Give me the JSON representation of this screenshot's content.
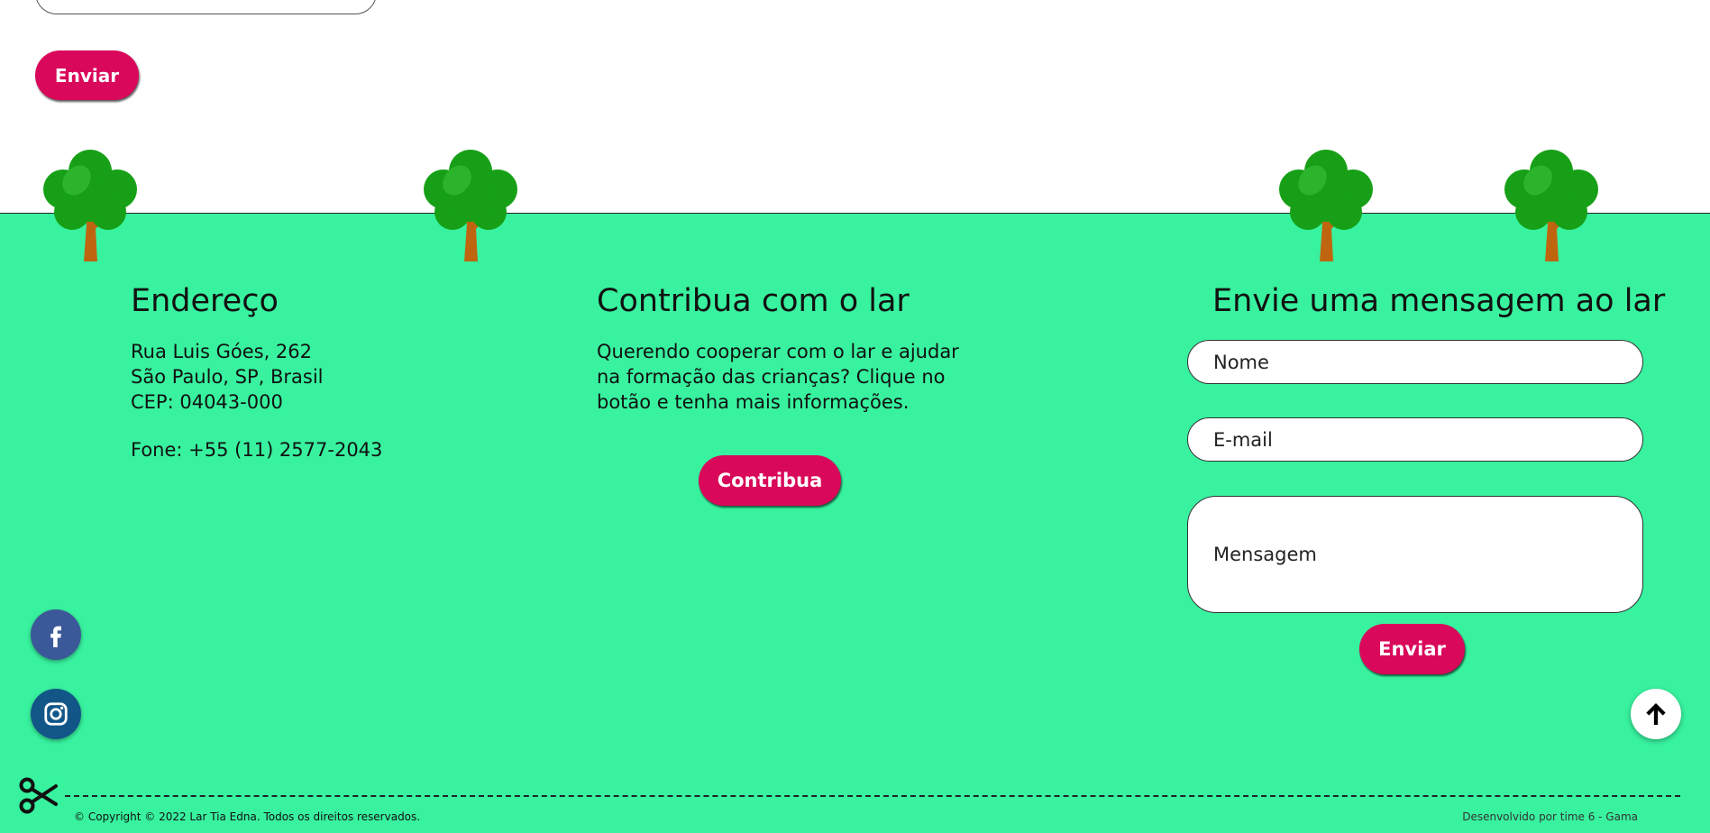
{
  "form_top": {
    "send_label": "Enviar"
  },
  "colors": {
    "accent": "#d9085a",
    "footer_bg": "#38f29f",
    "facebook": "#3b5998",
    "instagram": "#125688"
  },
  "address": {
    "title": "Endereço",
    "line1": "Rua Luis Góes, 262",
    "line2": "São Paulo, SP, Brasil",
    "line3": "CEP: 04043-000",
    "phone": "Fone: +55 (11) 2577-2043"
  },
  "contribute": {
    "title": "Contribua com o lar",
    "text": "Querendo cooperar com o lar e ajudar na formação das crianças? Clique no botão e tenha mais informações.",
    "button_label": "Contribua"
  },
  "message": {
    "title": "Envie uma mensagem ao lar",
    "name_placeholder": "Nome",
    "email_placeholder": "E-mail",
    "message_placeholder": "Mensagem",
    "send_label": "Enviar"
  },
  "social": {
    "facebook_icon": "facebook-icon",
    "instagram_icon": "instagram-icon"
  },
  "back_to_top_icon": "arrow-up-icon",
  "bottom": {
    "copyright": "© Copyright © 2022 Lar Tia Edna. Todos os direitos reservados.",
    "developed_by": "Desenvolvido por time 6 - Gama"
  }
}
